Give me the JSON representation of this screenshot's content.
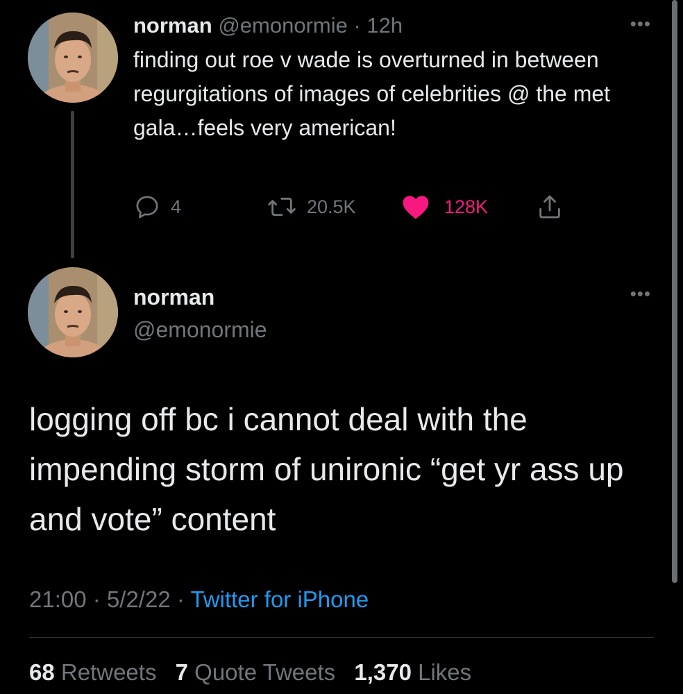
{
  "tweet1": {
    "name": "norman",
    "handle": "@emonormie",
    "separator": "·",
    "time": "12h",
    "text": "finding out roe v wade is overturned in between regurgitations of images of celebrities @ the met gala…feels very american!",
    "replies": "4",
    "retweets": "20.5K",
    "likes": "128K",
    "liked": true,
    "more_icon": "more-options-icon"
  },
  "tweet2": {
    "name": "norman",
    "handle": "@emonormie",
    "text": "logging off bc i cannot deal with the impending storm of unironic “get yr ass up and vote” content",
    "time": "21:00",
    "separator": "·",
    "date": "5/2/22",
    "source": "Twitter for iPhone",
    "more_icon": "more-options-icon"
  },
  "stats": {
    "retweets_count": "68",
    "retweets_label": "Retweets",
    "quotes_count": "7",
    "quotes_label": "Quote Tweets",
    "likes_count": "1,370",
    "likes_label": "Likes"
  },
  "colors": {
    "background": "#000000",
    "text": "#e7e9ea",
    "muted": "#71767b",
    "like": "#f91880",
    "link": "#1d9bf0"
  }
}
